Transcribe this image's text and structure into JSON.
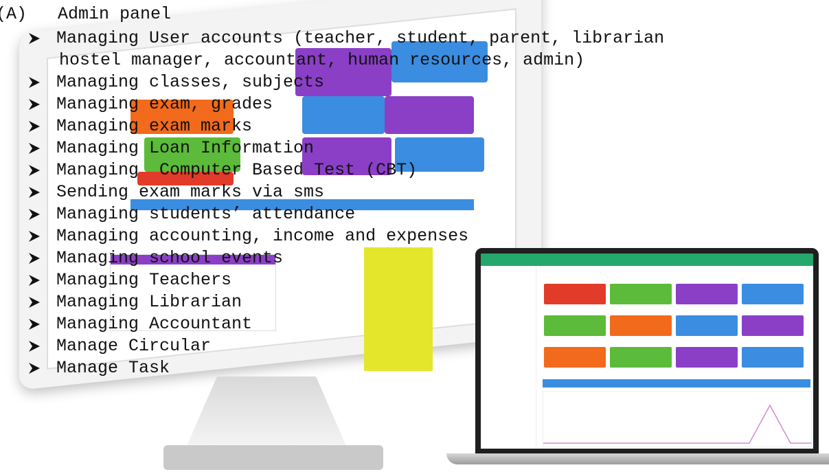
{
  "heading": {
    "label": "(A)",
    "title": "Admin panel"
  },
  "items": [
    {
      "text": "Managing User accounts (teacher, student, parent, librarian",
      "continuation": "hostel manager, accountant, human resources, admin)"
    },
    {
      "text": "Managing classes, subjects"
    },
    {
      "text": "Managing exam, grades"
    },
    {
      "text": "Managing exam marks"
    },
    {
      "text": "Managing Loan Information"
    },
    {
      "text": "Managing  Computer Based Test (CBT)"
    },
    {
      "text": "Sending exam marks via sms"
    },
    {
      "text": "Managing students’ attendance"
    },
    {
      "text": "Managing accounting, income and expenses"
    },
    {
      "text": "Managing school events"
    },
    {
      "text": "Managing Teachers"
    },
    {
      "text": "Managing Librarian"
    },
    {
      "text": "Managing Accountant"
    },
    {
      "text": "Manage Circular"
    },
    {
      "text": "Manage Task"
    }
  ],
  "colors": {
    "tile_orange": "#f26a1b",
    "tile_green": "#5cbb3a",
    "tile_purple": "#8b3fc7",
    "tile_blue": "#3a8de0",
    "tile_red": "#e23b2a",
    "tile_yellow": "#e4e62b"
  },
  "icons": {
    "bullet": "arrow-bullet-icon"
  }
}
